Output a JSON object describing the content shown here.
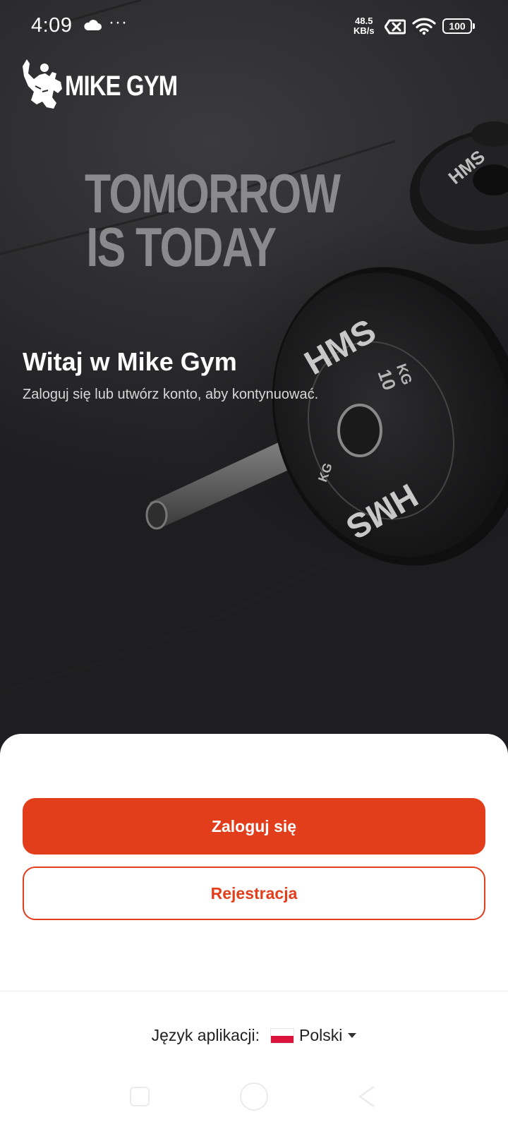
{
  "status_bar": {
    "time": "4:09",
    "more": "···",
    "speed_value": "48.5",
    "speed_unit": "KB/s",
    "battery": "100"
  },
  "brand": {
    "name": "MIKE GYM",
    "slogan_line1": "TOMORROW",
    "slogan_line2": "IS TODAY",
    "accent_color": "#e23e1b"
  },
  "welcome": {
    "title": "Witaj w Mike Gym",
    "subtitle": "Zaloguj się lub utwórz konto, aby kontynuować."
  },
  "actions": {
    "login_label": "Zaloguj się",
    "register_label": "Rejestracja"
  },
  "language": {
    "label": "Język aplikacji:",
    "selected": "Polski",
    "flag_icon": "poland-flag-icon"
  },
  "hero_plates": {
    "brand": "HMS",
    "unit": "KG",
    "weight": "10"
  }
}
